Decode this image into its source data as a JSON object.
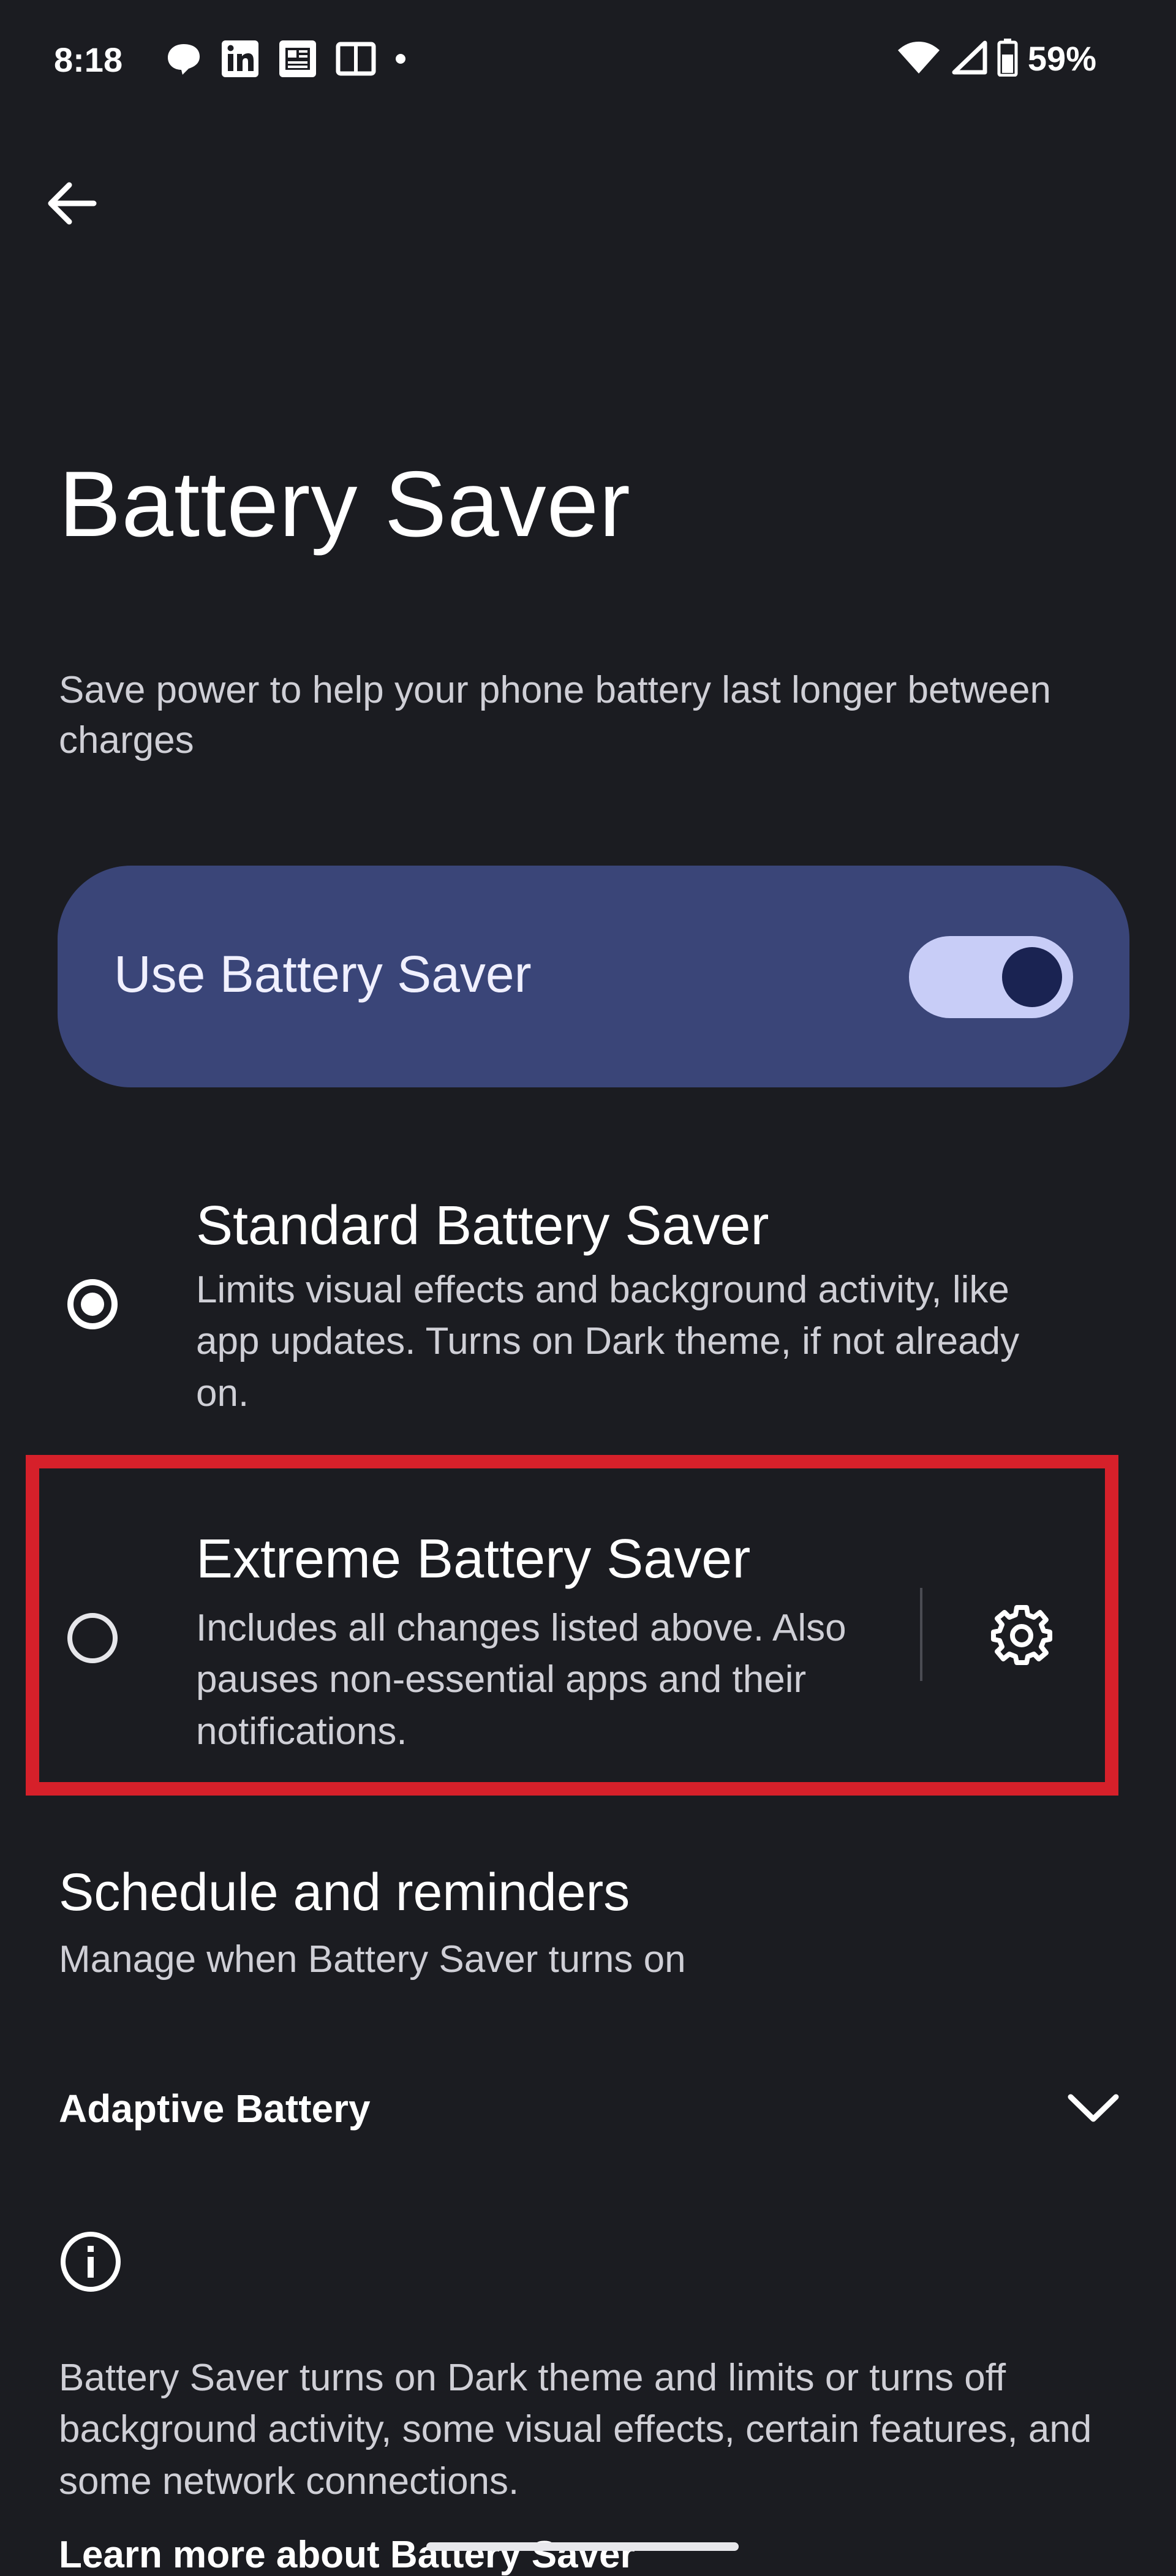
{
  "status_bar": {
    "time": "8:18",
    "battery_percent": "59%",
    "notification_icons": [
      "chat-bubble-icon",
      "linkedin-icon",
      "news-icon",
      "book-icon",
      "dot-icon"
    ],
    "system_icons": [
      "wifi-icon",
      "cellular-signal-icon",
      "battery-icon"
    ]
  },
  "header": {
    "back_icon": "back-arrow-icon",
    "title": "Battery Saver",
    "subtitle": "Save power to help your phone battery last longer between charges"
  },
  "main_toggle": {
    "label": "Use Battery Saver",
    "on": true,
    "card_color": "#3a4578"
  },
  "options": [
    {
      "title": "Standard Battery Saver",
      "description": "Limits visual effects and background activity, like app updates. Turns on Dark theme, if not already on.",
      "selected": true
    },
    {
      "title": "Extreme Battery Saver",
      "description": "Includes all changes listed above. Also pauses non-essential apps and their notifications.",
      "selected": false,
      "settings_icon": "gear-icon"
    }
  ],
  "highlight_color": "#d6202a",
  "schedule": {
    "title": "Schedule and reminders",
    "subtitle": "Manage when Battery Saver turns on"
  },
  "adaptive_battery": {
    "title": "Adaptive Battery",
    "expand_icon": "chevron-down-icon"
  },
  "footer": {
    "info_icon": "info-icon",
    "text": "Battery Saver turns on Dark theme and limits or turns off background activity, some visual effects, certain features, and some network connections.",
    "learn_more": "Learn more about Battery Saver"
  }
}
